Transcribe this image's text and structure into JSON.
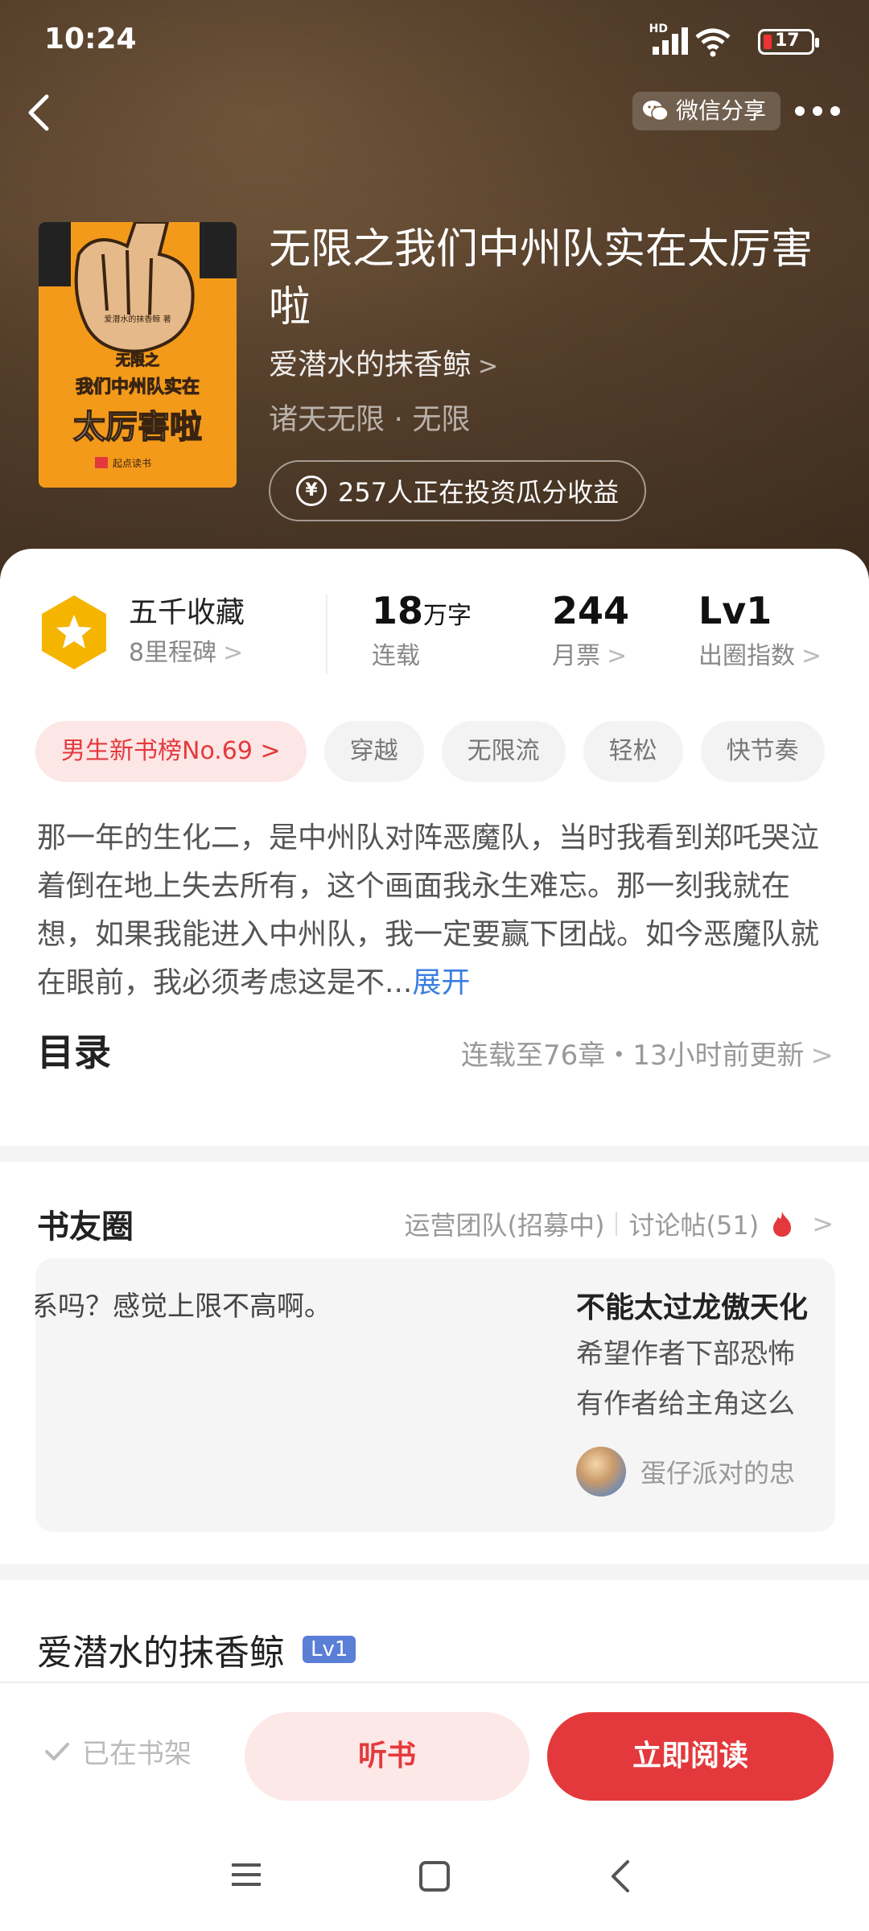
{
  "status_bar": {
    "time": "10:24",
    "network": "HD",
    "battery": "17"
  },
  "nav": {
    "share_label": "微信分享"
  },
  "book": {
    "title": "无限之我们中州队实在太厉害啦",
    "author": "爱潜水的抹香鲸",
    "genre": "诸天无限 · 无限",
    "invest_text": "257人正在投资瓜分收益",
    "cover_text": {
      "small": "爱潜水的抹香鲸 著",
      "line1": "无限之",
      "line2": "我们中州队实在",
      "line3": "太厉害啦",
      "publisher": "起点读书"
    }
  },
  "stats": {
    "collection_title": "五千收藏",
    "collection_sub": "8里程碑",
    "words_value": "18",
    "words_unit": "万字",
    "words_label": "连载",
    "tickets_value": "244",
    "tickets_label": "月票",
    "level_value": "Lv1",
    "level_label": "出圈指数"
  },
  "tags": [
    "男生新书榜No.69 >",
    "穿越",
    "无限流",
    "轻松",
    "快节奏"
  ],
  "description": {
    "text": "那一年的生化二，是中州队对阵恶魔队，当时我看到郑吒哭泣着倒在地上失去所有，这个画面我永生难忘。那一刻我就在想，如果我能进入中州队，我一定要赢下团战。如今恶魔队就在眼前，我必须考虑这是不...",
    "expand": "展开"
  },
  "toc": {
    "title": "目录",
    "status": "连载至76章・13小时前更新"
  },
  "circle": {
    "title": "书友圈",
    "team": "运营团队(招募中)",
    "discussions": "讨论帖(51)",
    "post_left": "关系吗？感觉上限不高啊。",
    "post_right_title": "不能太过龙傲天化",
    "post_right_line1": "希望作者下部恐怖",
    "post_right_line2": "有作者给主角这么",
    "post_right_user": "蛋仔派对的忠"
  },
  "author_section": {
    "name": "爱潜水的抹香鲸",
    "level": "Lv1"
  },
  "actions": {
    "shelf": "已在书架",
    "listen": "听书",
    "read": "立即阅读"
  },
  "colors": {
    "accent": "#e4393c",
    "link": "#3b7de0",
    "badge_gold": "#f4b400"
  }
}
